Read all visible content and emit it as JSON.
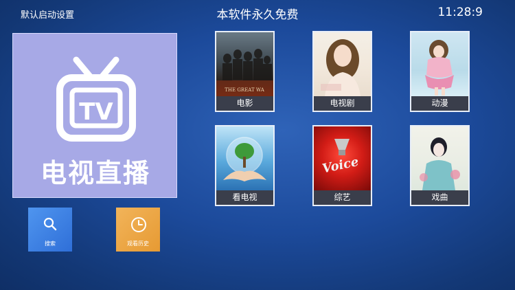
{
  "header": {
    "settings_link": "默认启动设置",
    "title": "本软件永久免费",
    "clock": "11:28:9"
  },
  "live_tv": {
    "icon": "tv-icon",
    "icon_text": "TV",
    "label": "电视直播"
  },
  "shortcuts": {
    "search": {
      "label": "搜索",
      "icon": "search-icon"
    },
    "history": {
      "label": "观看历史",
      "icon": "clock-icon"
    }
  },
  "categories": [
    {
      "label": "电影"
    },
    {
      "label": "电视剧"
    },
    {
      "label": "动漫"
    },
    {
      "label": "看电视"
    },
    {
      "label": "综艺"
    },
    {
      "label": "戏曲"
    }
  ],
  "poster_text": {
    "movie": "THE GREAT WA",
    "variety": "Voice"
  },
  "colors": {
    "live_tile_bg": "#a7a9e6",
    "search_btn": "#3f86e6",
    "history_btn": "#eeaa4a",
    "background": "#1c4a9b"
  }
}
